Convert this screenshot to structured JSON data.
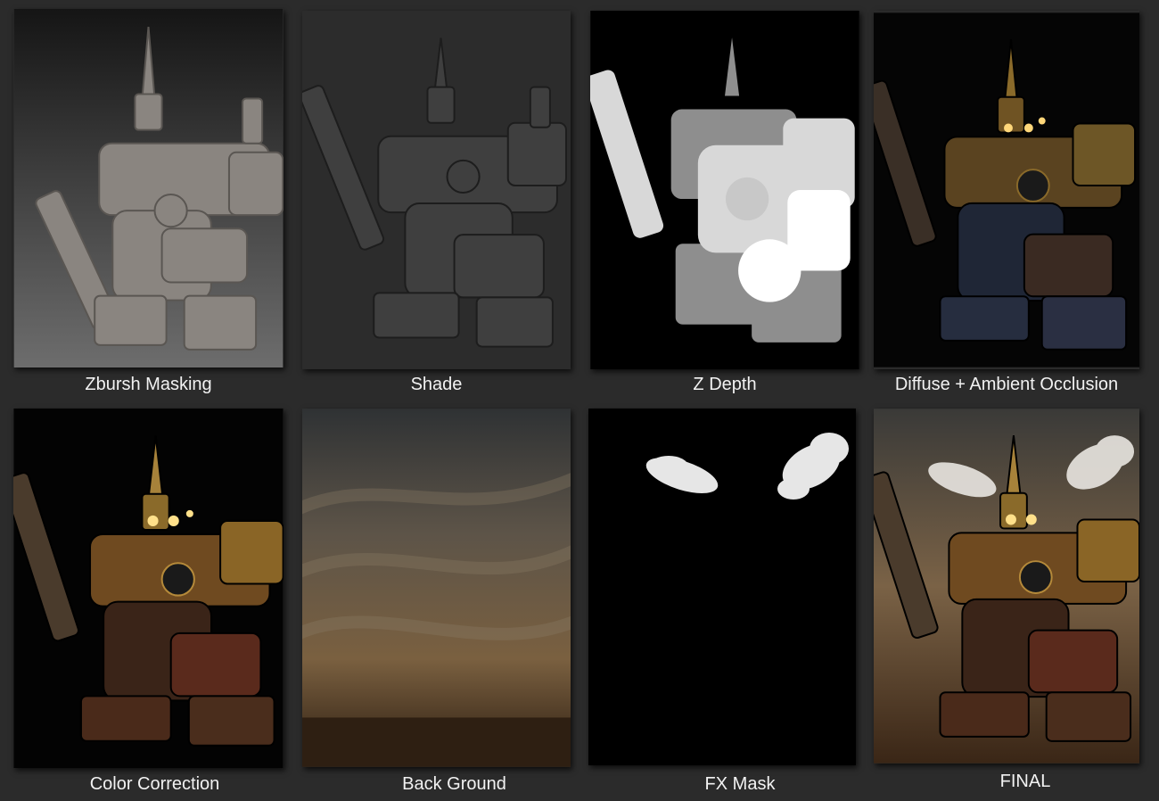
{
  "panels": [
    {
      "caption": "Zbursh Masking",
      "render": "clay-sculpt"
    },
    {
      "caption": "Shade",
      "render": "grey-shade"
    },
    {
      "caption": "Z Depth",
      "render": "white-depth-silhouette"
    },
    {
      "caption": "Diffuse + Ambient Occlusion",
      "render": "textured-dark"
    },
    {
      "caption": "Color Correction",
      "render": "textured-warm"
    },
    {
      "caption": "Back Ground",
      "render": "dusty-sky"
    },
    {
      "caption": "FX Mask",
      "render": "smoke-puffs"
    },
    {
      "caption": "FINAL",
      "render": "composite"
    }
  ]
}
